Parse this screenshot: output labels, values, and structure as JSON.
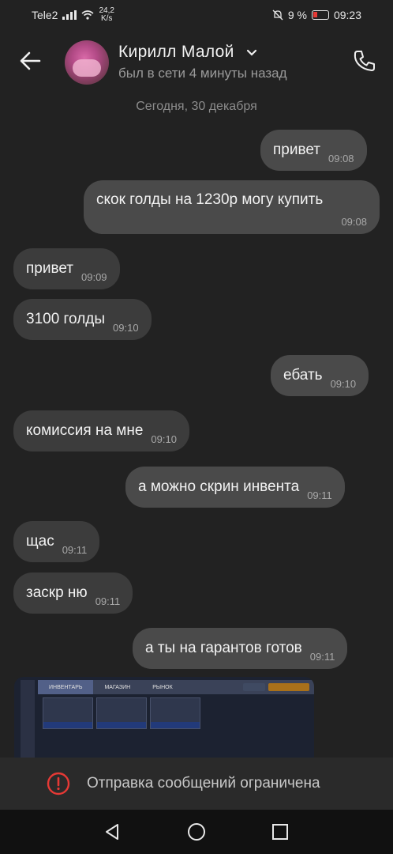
{
  "status_bar": {
    "carrier": "Tele2",
    "net_speed_value": "24,2",
    "net_speed_unit": "K/s",
    "battery_percent": "9 %",
    "time": "09:23"
  },
  "header": {
    "contact_name": "Кирилл Малой",
    "last_seen": "был в сети 4 минуты назад"
  },
  "chat": {
    "date_separator": "Сегодня, 30 декабря",
    "messages": [
      {
        "text": "привет",
        "time": "09:08",
        "direction": "out"
      },
      {
        "text": "скок голды на 1230р могу купить",
        "time": "09:08",
        "direction": "out"
      },
      {
        "text": "привет",
        "time": "09:09",
        "direction": "in"
      },
      {
        "text": "3100 голды",
        "time": "09:10",
        "direction": "in"
      },
      {
        "text": "ебать",
        "time": "09:10",
        "direction": "out"
      },
      {
        "text": "комиссия на мне",
        "time": "09:10",
        "direction": "in"
      },
      {
        "text": "а можно скрин инвента",
        "time": "09:11",
        "direction": "out"
      },
      {
        "text": "щас",
        "time": "09:11",
        "direction": "in"
      },
      {
        "text": "заскр ню",
        "time": "09:11",
        "direction": "in"
      },
      {
        "text": "а ты на гарантов готов",
        "time": "09:11",
        "direction": "out"
      }
    ],
    "screenshot_tabs": [
      "ИНВЕНТАРЬ",
      "МАГАЗИН",
      "РЫНОК"
    ]
  },
  "composer": {
    "restricted_text": "Отправка сообщений ограничена"
  },
  "icons": {
    "back": "back-arrow-icon",
    "call": "phone-icon",
    "warning": "warning-icon",
    "nav_back": "triangle-back-icon",
    "nav_home": "circle-home-icon",
    "nav_recent": "square-recent-icon"
  },
  "colors": {
    "background": "#222222",
    "bubble_out": "#4a4a4a",
    "bubble_in": "#3c3c3c",
    "warning": "#e53935"
  }
}
